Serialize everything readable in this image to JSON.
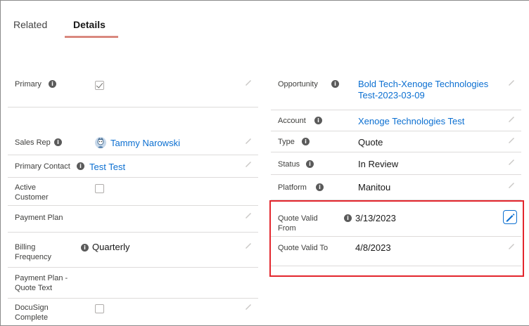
{
  "tabs": {
    "related": "Related",
    "details": "Details"
  },
  "left_fields": {
    "primary": {
      "label": "Primary"
    },
    "sales_rep": {
      "label": "Sales Rep",
      "value": "Tammy Narowski"
    },
    "primary_contact": {
      "label": "Primary Contact",
      "value": "Test Test"
    },
    "active_customer": {
      "label_line1": "Active",
      "label_line2": "Customer"
    },
    "payment_plan": {
      "label": "Payment Plan"
    },
    "billing_frequency": {
      "label_line1": "Billing",
      "label_line2": "Frequency",
      "value": "Quarterly"
    },
    "payment_plan_quote_text": {
      "label_line1": "Payment Plan -",
      "label_line2": "Quote Text"
    },
    "docusign_complete": {
      "label_line1": "DocuSign",
      "label_line2": "Complete"
    }
  },
  "right_fields": {
    "opportunity": {
      "label": "Opportunity",
      "value_line1": "Bold Tech-Xenoge Technologies",
      "value_line2": "Test-2023-03-09"
    },
    "account": {
      "label": "Account",
      "value": "Xenoge Technologies Test"
    },
    "type": {
      "label": "Type",
      "value": "Quote"
    },
    "status": {
      "label": "Status",
      "value": "In Review"
    },
    "platform": {
      "label": "Platform",
      "value": "Manitou"
    },
    "quote_valid_from": {
      "label_line1": "Quote Valid",
      "label_line2": "From",
      "value": "3/13/2023"
    },
    "quote_valid_to": {
      "label": "Quote Valid To",
      "value": "4/8/2023"
    }
  },
  "icons": {
    "info": "info-icon",
    "edit": "pencil-icon",
    "avatar": "user-avatar"
  },
  "colors": {
    "link": "#0b6fd1",
    "tab_underline": "#d9897f",
    "highlight": "#e3262d"
  }
}
